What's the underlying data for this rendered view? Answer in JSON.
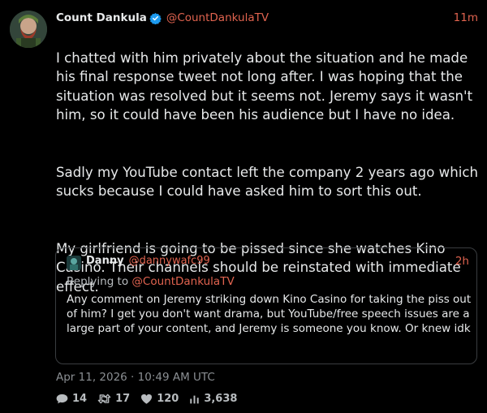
{
  "tweet": {
    "author_name": "Count Dankula",
    "author_handle": "@CountDankulaTV",
    "time": "11m",
    "paragraphs": [
      "I chatted with him privately about the situation and he made his final response tweet not long after. I was hoping that the situation was resolved but it seems not. Jeremy says it wasn't him, so it could have been his audience but I have no idea.",
      "Sadly my YouTube contact left the company 2 years ago which sucks because I could have asked him to sort this out.",
      "My girlfriend is going to be pissed since she watches Kino Casino. Their channels should be reinstated with immediate effect."
    ],
    "date": "Apr 11, 2026 · 10:49 AM UTC"
  },
  "quote": {
    "author_name": "Danny",
    "author_handle": "@dannywafc99",
    "time": "2h",
    "replying_prefix": "Replying to",
    "replying_to": "@CountDankulaTV",
    "text": "Any comment on Jeremy striking down Kino Casino for taking the piss out of him? I get you don't want drama, but YouTube/free speech issues are a large part of your content, and Jeremy is someone you know. Or knew idk"
  },
  "stats": {
    "replies": "14",
    "retweets": "17",
    "likes": "120",
    "views": "3,638"
  },
  "icons": {
    "verified": "verified-badge-icon",
    "reply": "comment-icon",
    "retweet": "retweet-icon",
    "like": "heart-icon",
    "views": "bar-chart-icon"
  },
  "colors": {
    "background": "#000000",
    "accent": "#e0634f",
    "text": "#e7e9ea",
    "muted": "#8b8f93",
    "verified": "#1d9bf0"
  }
}
